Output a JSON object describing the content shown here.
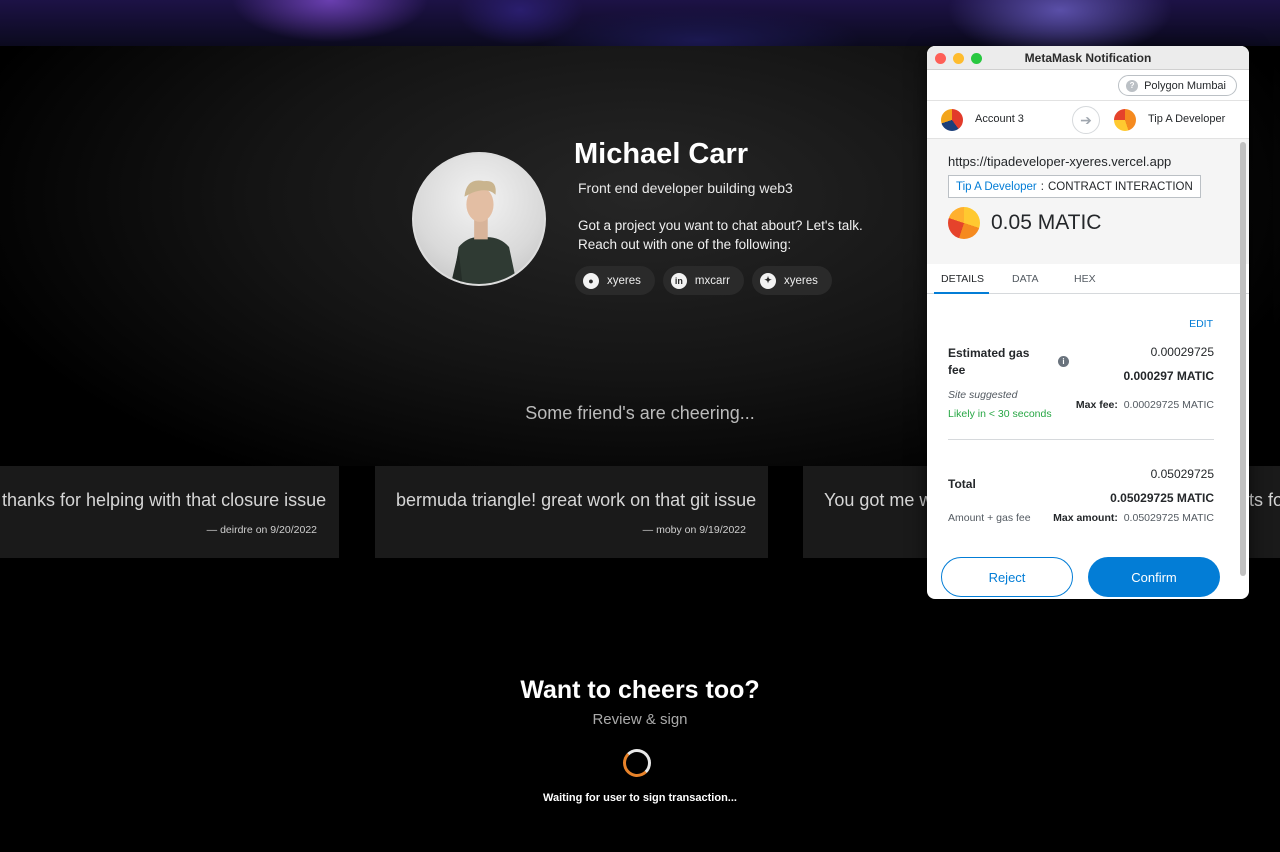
{
  "profile": {
    "name": "Michael Carr",
    "tagline": "Front end developer building web3",
    "pitch_line1": "Got a project you want to chat about? Let's talk.",
    "pitch_line2": "Reach out with one of the following:",
    "socials": [
      {
        "icon": "github-icon",
        "glyph": "●",
        "label": "xyeres"
      },
      {
        "icon": "linkedin-icon",
        "glyph": "in",
        "label": "mxcarr"
      },
      {
        "icon": "twitter-icon",
        "glyph": "✦",
        "label": "xyeres"
      }
    ]
  },
  "cheers": {
    "heading": "Some friend's are cheering...",
    "cards": [
      {
        "message": "thanks for helping with that closure issue",
        "byline": "— deirdre on 9/20/2022"
      },
      {
        "message": "bermuda triangle! great work on that git issue",
        "byline": "— moby on 9/19/2022"
      },
      {
        "message": "You got me w",
        "trailing": "ts fo"
      }
    ]
  },
  "cta": {
    "title": "Want to cheers too?",
    "subtitle": "Review & sign",
    "waiting": "Waiting for user to sign transaction..."
  },
  "metamask": {
    "window_title": "MetaMask Notification",
    "network": "Polygon Mumbai",
    "from_account": "Account 3",
    "to_account": "Tip A Developer",
    "origin": "https://tipadeveloper-xyeres.vercel.app",
    "contract_name": "Tip A Developer",
    "contract_sep": ":",
    "contract_type": "CONTRACT INTERACTION",
    "amount": "0.05 MATIC",
    "tabs": [
      "DETAILS",
      "DATA",
      "HEX"
    ],
    "active_tab": "DETAILS",
    "edit": "EDIT",
    "gas": {
      "label_line1": "Estimated gas",
      "label_line2": "fee",
      "value": "0.00029725",
      "value_bold": "0.000297 MATIC",
      "site_suggested": "Site suggested",
      "likely": "Likely in < 30 seconds",
      "max_fee_label": "Max fee:",
      "max_fee_value": "0.00029725 MATIC"
    },
    "total": {
      "label": "Total",
      "value": "0.05029725",
      "value_bold": "0.05029725 MATIC",
      "amount_gas": "Amount + gas fee",
      "max_amount_label": "Max amount:",
      "max_amount_value": "0.05029725 MATIC"
    },
    "reject": "Reject",
    "confirm": "Confirm",
    "colors": {
      "primary": "#037dd6",
      "success": "#28a745"
    }
  }
}
